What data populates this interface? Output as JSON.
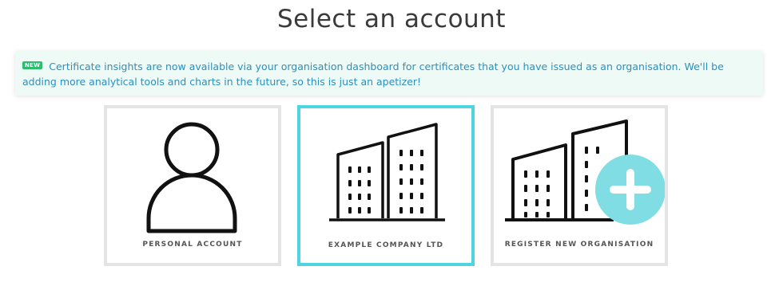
{
  "page": {
    "title": "Select an account"
  },
  "notice": {
    "badge": "NEW",
    "text": "Certificate insights are now available via your organisation dashboard for certificates that you have issued as an organisation. We'll be adding more analytical tools and charts in the future, so this is just an apetizer!"
  },
  "accounts": [
    {
      "label": "PERSONAL ACCOUNT",
      "icon": "person-icon",
      "selected": false
    },
    {
      "label": "EXAMPLE COMPANY LTD",
      "icon": "building-icon",
      "selected": true
    },
    {
      "label": "REGISTER NEW ORGANISATION",
      "icon": "building-plus-icon",
      "selected": false
    }
  ],
  "colors": {
    "selected_border": "#4fd5e0",
    "card_border": "#e4e4e4",
    "notice_background": "#eefaf5",
    "notice_text": "#2b8fbe",
    "badge": "#2dbd6e",
    "plus_circle": "#7fdde3"
  }
}
